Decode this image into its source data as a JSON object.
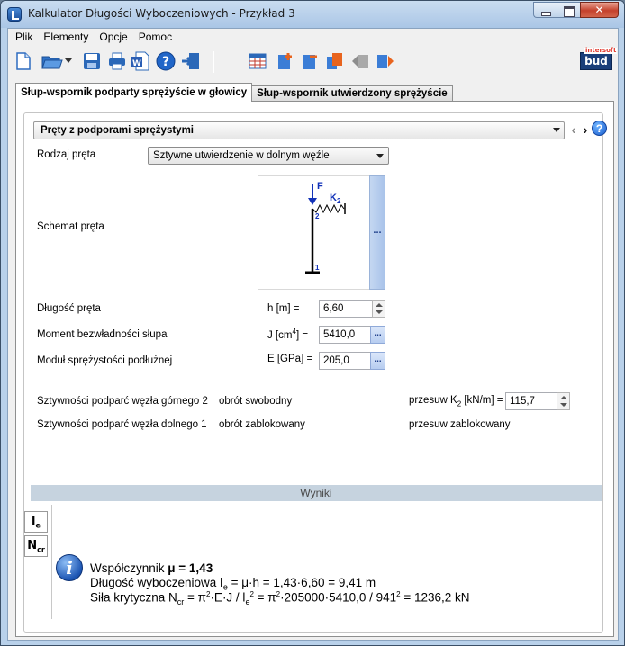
{
  "window": {
    "title": "Kalkulator Długości Wyboczeniowych - Przykład 3"
  },
  "menu": [
    "Plik",
    "Elementy",
    "Opcje",
    "Pomoc"
  ],
  "toolbar": {
    "icons": [
      "new-file-icon",
      "open-folder-icon",
      "dropdown-arrow-icon",
      "save-icon",
      "print-icon",
      "word-export-icon",
      "help-icon",
      "exit-icon",
      "table-icon",
      "add-element-icon",
      "remove-element-icon",
      "copy-element-icon",
      "move-left-icon",
      "move-right-icon"
    ],
    "logo_main": "bud",
    "logo_top": "intersoft"
  },
  "tabs": [
    "Słup-wspornik podparty sprężyście w głowicy",
    "Słup-wspornik utwierdzony sprężyście"
  ],
  "section": {
    "title": "Pręty z podporami sprężystymi",
    "help": "?"
  },
  "form": {
    "rodzaj_label": "Rodzaj pręta",
    "rodzaj_value": "Sztywne utwierdzenie w dolnym węźle",
    "schemat_label": "Schemat pręta",
    "schemat_btn": "...",
    "schema": {
      "force": "F",
      "spring": "K",
      "spring_sub": "2",
      "node_top": "2",
      "node_bottom": "1"
    },
    "dlugosc_label": "Długość pręta",
    "dlugosc_unit": "h [m] =",
    "dlugosc_value": "6,60",
    "moment_label": "Moment bezwładności słupa",
    "moment_unit_pre": "J [cm",
    "moment_unit_sup": "4",
    "moment_unit_post": "] =",
    "moment_value": "5410,0",
    "modul_label": "Moduł sprężystości podłużnej",
    "modul_unit": "E [GPa] =",
    "modul_value": "205,0",
    "dots": "...",
    "gorny_label": "Sztywności podparć węzła górnego 2",
    "gorny_obrot": "obrót  swobodny",
    "gorny_przesuw_pre": "przesuw  K",
    "gorny_przesuw_sub": "2",
    "gorny_przesuw_post": " [kN/m] =",
    "gorny_przesuw_value": "115,7",
    "dolny_label": "Sztywności podparć węzła dolnego 1",
    "dolny_obrot": "obrót  zablokowany",
    "dolny_przesuw": "przesuw  zablokowany"
  },
  "results": {
    "header": "Wyniki",
    "btn_le_main": "l",
    "btn_le_sub": "e",
    "btn_ncr_main": "N",
    "btn_ncr_sub": "cr",
    "info": "i",
    "line1_label": "Współczynnik   ",
    "line1_value": "μ = 1,43",
    "line2_label": "Długość wyboczeniowa   ",
    "line2_sym": "l",
    "line2_sub": "e",
    "line2_rest": " = μ·h = 1,43·6,60 = 9,41 m",
    "line3_label": "Siła krytyczna    N",
    "line3_sub": "cr",
    "line3_a": " = π",
    "line3_sup1": "2",
    "line3_b": "·E·J / l",
    "line3_sub2": "e",
    "line3_sup2": "2",
    "line3_c": " = π",
    "line3_sup3": "2",
    "line3_d": "·205000·5410,0 / 941",
    "line3_sup4": "2",
    "line3_e": " = 1236,2 kN"
  }
}
